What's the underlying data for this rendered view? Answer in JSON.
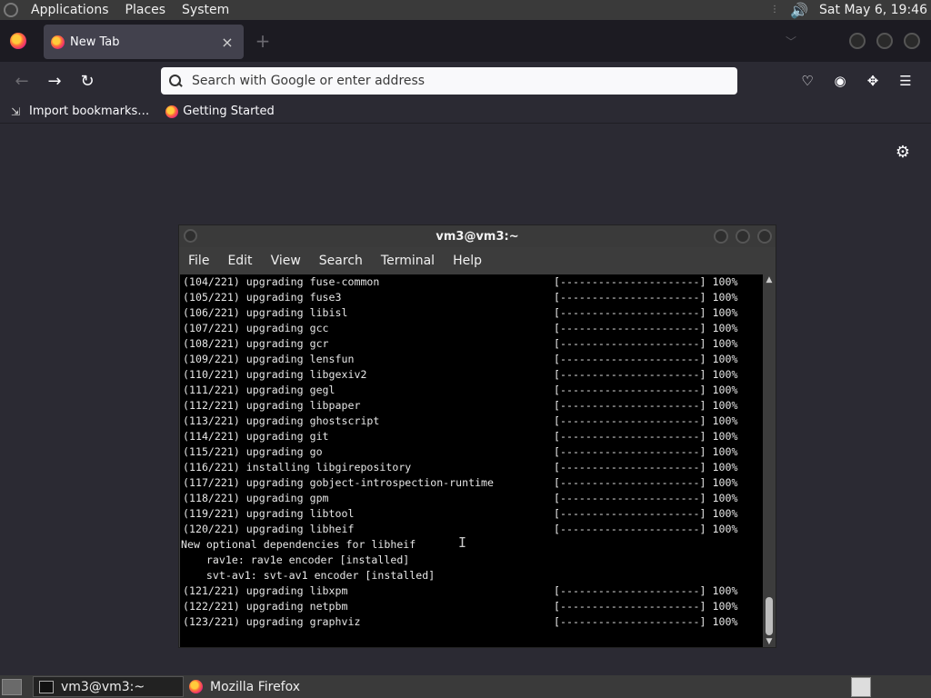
{
  "top_panel": {
    "menus": [
      "Applications",
      "Places",
      "System"
    ],
    "clock": "Sat May  6, 19:46"
  },
  "browser": {
    "tab_title": "New Tab",
    "tab_close": "×",
    "new_tab": "+",
    "search_placeholder": "Search with Google or enter address",
    "bookmarks": [
      "Import bookmarks…",
      "Getting Started"
    ]
  },
  "terminal": {
    "title": "vm3@vm3:~",
    "menu": [
      "File",
      "Edit",
      "View",
      "Search",
      "Terminal",
      "Help"
    ],
    "lines": [
      {
        "left": "(104/221) upgrading fuse-common",
        "right": "[----------------------] 100%"
      },
      {
        "left": "(105/221) upgrading fuse3",
        "right": "[----------------------] 100%"
      },
      {
        "left": "(106/221) upgrading libisl",
        "right": "[----------------------] 100%"
      },
      {
        "left": "(107/221) upgrading gcc",
        "right": "[----------------------] 100%"
      },
      {
        "left": "(108/221) upgrading gcr",
        "right": "[----------------------] 100%"
      },
      {
        "left": "(109/221) upgrading lensfun",
        "right": "[----------------------] 100%"
      },
      {
        "left": "(110/221) upgrading libgexiv2",
        "right": "[----------------------] 100%"
      },
      {
        "left": "(111/221) upgrading gegl",
        "right": "[----------------------] 100%"
      },
      {
        "left": "(112/221) upgrading libpaper",
        "right": "[----------------------] 100%"
      },
      {
        "left": "(113/221) upgrading ghostscript",
        "right": "[----------------------] 100%"
      },
      {
        "left": "(114/221) upgrading git",
        "right": "[----------------------] 100%"
      },
      {
        "left": "(115/221) upgrading go",
        "right": "[----------------------] 100%"
      },
      {
        "left": "(116/221) installing libgirepository",
        "right": "[----------------------] 100%"
      },
      {
        "left": "(117/221) upgrading gobject-introspection-runtime",
        "right": "[----------------------] 100%"
      },
      {
        "left": "(118/221) upgrading gpm",
        "right": "[----------------------] 100%"
      },
      {
        "left": "(119/221) upgrading libtool",
        "right": "[----------------------] 100%"
      },
      {
        "left": "(120/221) upgrading libheif",
        "right": "[----------------------] 100%"
      },
      {
        "left": "New optional dependencies for libheif",
        "right": "",
        "msg": true
      },
      {
        "left": "    rav1e: rav1e encoder [installed]",
        "right": "",
        "msg": true
      },
      {
        "left": "    svt-av1: svt-av1 encoder [installed]",
        "right": "",
        "msg": true
      },
      {
        "left": "(121/221) upgrading libxpm",
        "right": "[----------------------] 100%"
      },
      {
        "left": "(122/221) upgrading netpbm",
        "right": "[----------------------] 100%"
      },
      {
        "left": "(123/221) upgrading graphviz",
        "right": "[----------------------] 100%"
      }
    ]
  },
  "taskbar": {
    "tasks": [
      "vm3@vm3:~",
      "Mozilla Firefox"
    ]
  }
}
